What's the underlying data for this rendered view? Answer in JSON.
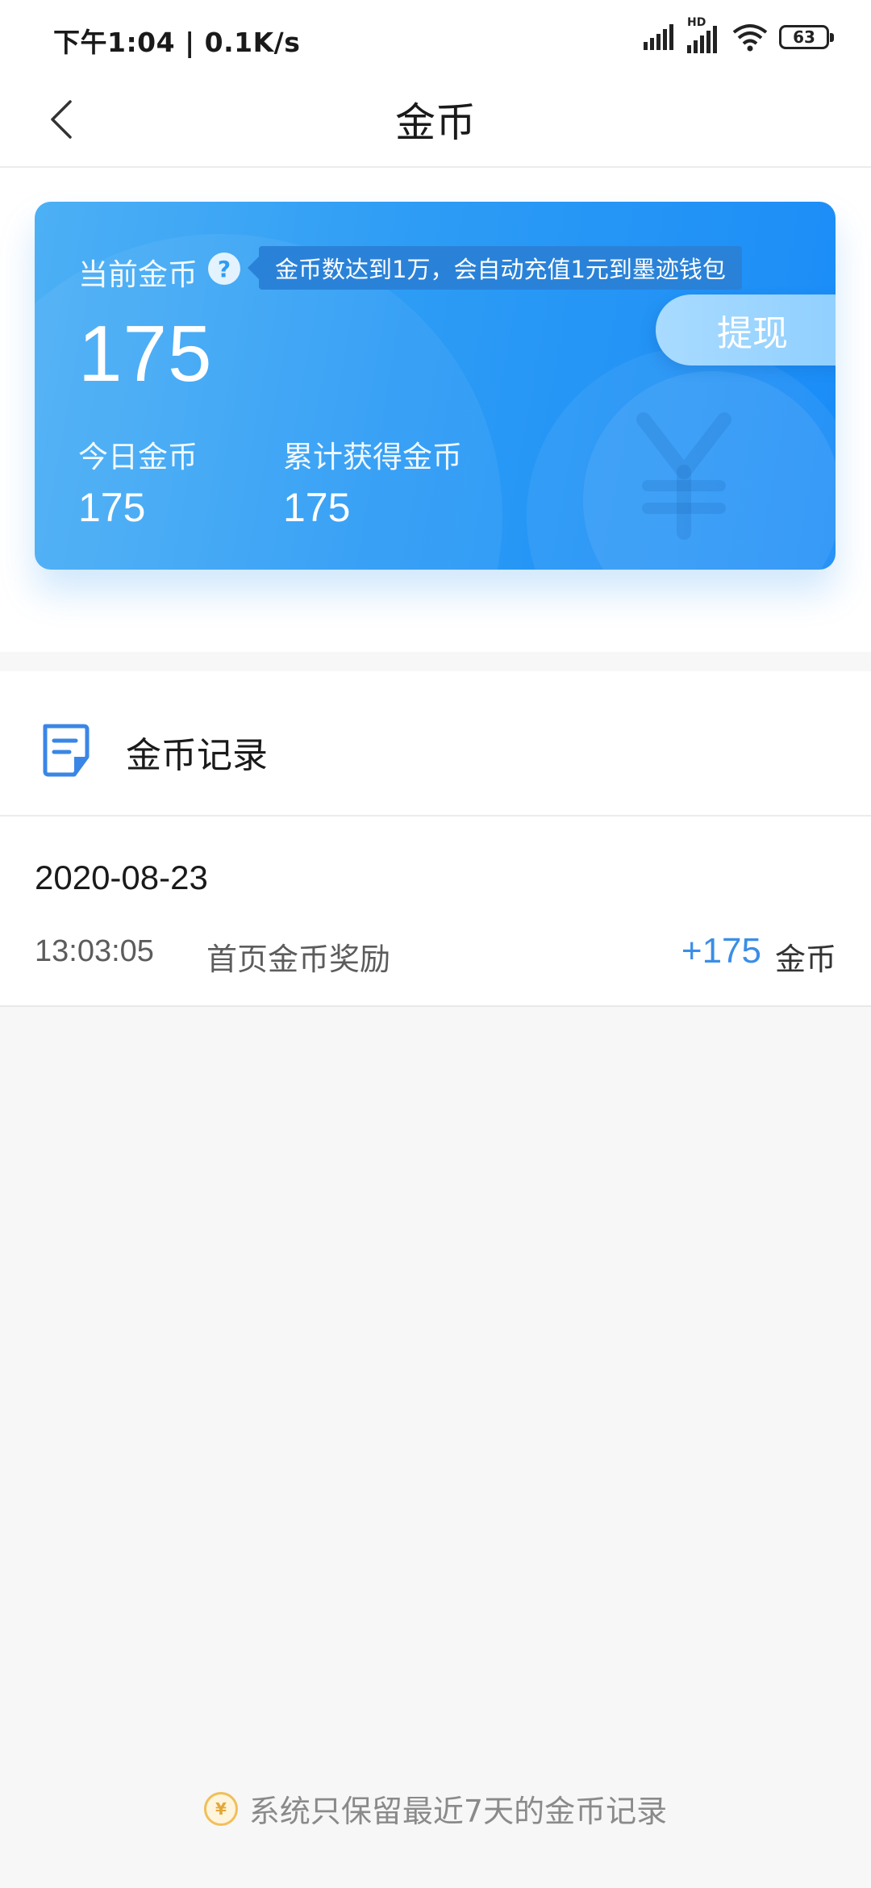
{
  "status_bar": {
    "time": "下午1:04 | 0.1K/s",
    "battery": "63",
    "hd": "HD"
  },
  "header": {
    "title": "金币"
  },
  "coin_card": {
    "current_label": "当前金币",
    "current_value": "175",
    "tooltip": "金币数达到1万，会自动充值1元到墨迹钱包",
    "withdraw_label": "提现",
    "today_label": "今日金币",
    "today_value": "175",
    "total_label": "累计获得金币",
    "total_value": "175",
    "colors": {
      "card_start": "#4db0f5",
      "card_end": "#1a8cf7",
      "amount_blue": "#3a8ee6"
    }
  },
  "records": {
    "title": "金币记录",
    "groups": [
      {
        "date": "2020-08-23",
        "items": [
          {
            "time": "13:03:05",
            "desc": "首页金币奖励",
            "amount": "+175",
            "unit": "金币"
          }
        ]
      }
    ]
  },
  "footer": {
    "note": "系统只保留最近7天的金币记录",
    "coin_symbol": "¥"
  }
}
